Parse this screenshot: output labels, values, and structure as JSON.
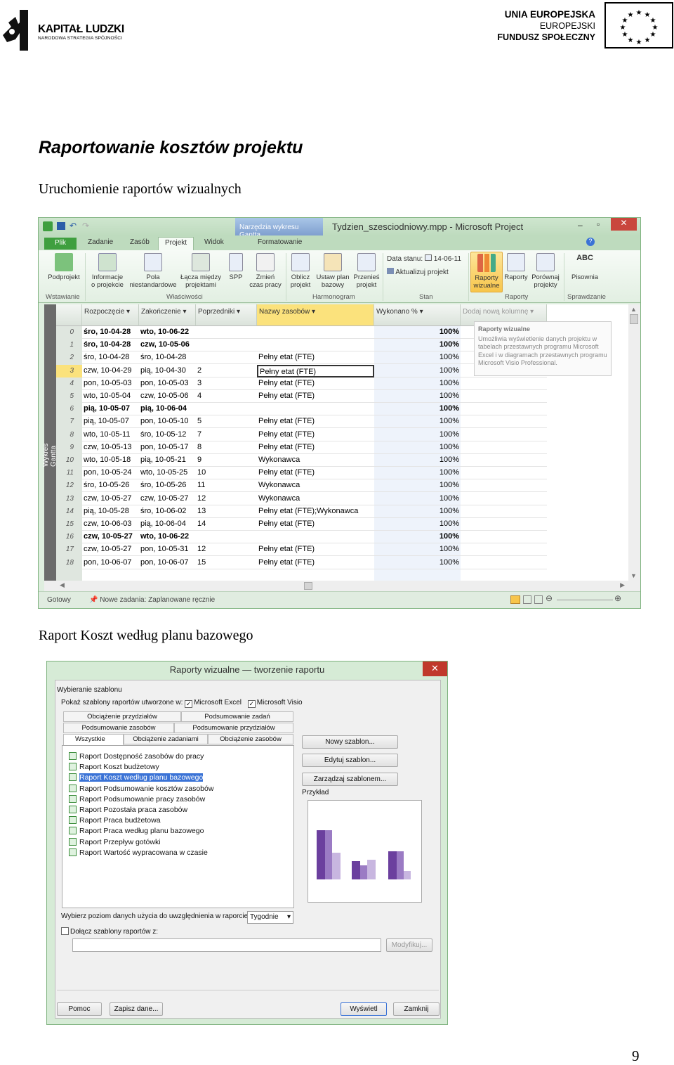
{
  "header": {
    "kl_title": "KAPITAŁ LUDZKI",
    "kl_subtitle": "NARODOWA STRATEGIA SPÓJNOŚCI",
    "ue_line1": "UNIA EUROPEJSKA",
    "ue_line2": "EUROPEJSKI",
    "ue_line3": "FUNDUSZ SPOŁECZNY"
  },
  "doc": {
    "title": "Raportowanie kosztów projektu",
    "sub1": "Uruchomienie raportów wizualnych",
    "sub2": "Raport Koszt według planu bazowego",
    "page_number": "9"
  },
  "project": {
    "app_title": "Tydzien_szesciodniowy.mpp  -  Microsoft Project",
    "context_tab": "Narzędzia wykresu Gantta",
    "tabs": [
      "Plik",
      "Zadanie",
      "Zasób",
      "Projekt",
      "Widok",
      "Formatowanie"
    ],
    "ribbon": {
      "podprojekt": "Podprojekt",
      "informacje": "Informacje\no projekcie",
      "pola": "Pola\nniestandardowe",
      "lacza": "Łącza między\nprojektami",
      "spp": "SPP",
      "zmien": "Zmień\nczas pracy",
      "oblicz": "Oblicz\nprojekt",
      "ustaw": "Ustaw plan\nbazowy",
      "przenies": "Przenieś\nprojekt",
      "data_stanu": "Data stanu:",
      "data_val": "14-06-11",
      "aktualizuj": "Aktualizuj projekt",
      "raporty_wiz": "Raporty\nwizualne",
      "raporty": "Raporty",
      "porownaj": "Porównaj\nprojekty",
      "pisownia": "Pisownia",
      "groups": [
        "Wstawianie",
        "Właściwości",
        "Harmonogram",
        "Stan",
        "Raporty",
        "Sprawdzanie"
      ]
    },
    "sidebar_label": "Wykres Gantta",
    "columns": [
      "Rozpoczęcie",
      "Zakończenie",
      "Poprzedniki",
      "Nazwy zasobów",
      "Wykonano %",
      "Dodaj nową kolumnę"
    ],
    "tooltip_title": "Raporty wizualne",
    "tooltip_text": "Umożliwia wyświetlenie danych projektu w tabelach przestawnych programu Microsoft Excel i w diagramach przestawnych programu Microsoft Visio Professional.",
    "rows": [
      {
        "n": "0",
        "start": "śro, 10-04-28",
        "end": "wto, 10-06-22",
        "pred": "",
        "res": "",
        "pct": "100%",
        "bold": true
      },
      {
        "n": "1",
        "start": "śro, 10-04-28",
        "end": "czw, 10-05-06",
        "pred": "",
        "res": "",
        "pct": "100%",
        "bold": true
      },
      {
        "n": "2",
        "start": "śro, 10-04-28",
        "end": "śro, 10-04-28",
        "pred": "",
        "res": "Pełny etat (FTE)",
        "pct": "100%",
        "bold": false
      },
      {
        "n": "3",
        "start": "czw, 10-04-29",
        "end": "pią, 10-04-30",
        "pred": "2",
        "res": "Pełny etat (FTE)",
        "pct": "100%",
        "bold": false
      },
      {
        "n": "4",
        "start": "pon, 10-05-03",
        "end": "pon, 10-05-03",
        "pred": "3",
        "res": "Pełny etat (FTE)",
        "pct": "100%",
        "bold": false
      },
      {
        "n": "5",
        "start": "wto, 10-05-04",
        "end": "czw, 10-05-06",
        "pred": "4",
        "res": "Pełny etat (FTE)",
        "pct": "100%",
        "bold": false
      },
      {
        "n": "6",
        "start": "pią, 10-05-07",
        "end": "pią, 10-06-04",
        "pred": "",
        "res": "",
        "pct": "100%",
        "bold": true
      },
      {
        "n": "7",
        "start": "pią, 10-05-07",
        "end": "pon, 10-05-10",
        "pred": "5",
        "res": "Pełny etat (FTE)",
        "pct": "100%",
        "bold": false
      },
      {
        "n": "8",
        "start": "wto, 10-05-11",
        "end": "śro, 10-05-12",
        "pred": "7",
        "res": "Pełny etat (FTE)",
        "pct": "100%",
        "bold": false
      },
      {
        "n": "9",
        "start": "czw, 10-05-13",
        "end": "pon, 10-05-17",
        "pred": "8",
        "res": "Pełny etat (FTE)",
        "pct": "100%",
        "bold": false
      },
      {
        "n": "10",
        "start": "wto, 10-05-18",
        "end": "pią, 10-05-21",
        "pred": "9",
        "res": "Wykonawca",
        "pct": "100%",
        "bold": false
      },
      {
        "n": "11",
        "start": "pon, 10-05-24",
        "end": "wto, 10-05-25",
        "pred": "10",
        "res": "Pełny etat (FTE)",
        "pct": "100%",
        "bold": false
      },
      {
        "n": "12",
        "start": "śro, 10-05-26",
        "end": "śro, 10-05-26",
        "pred": "11",
        "res": "Wykonawca",
        "pct": "100%",
        "bold": false
      },
      {
        "n": "13",
        "start": "czw, 10-05-27",
        "end": "czw, 10-05-27",
        "pred": "12",
        "res": "Wykonawca",
        "pct": "100%",
        "bold": false
      },
      {
        "n": "14",
        "start": "pią, 10-05-28",
        "end": "śro, 10-06-02",
        "pred": "13",
        "res": "Pełny etat (FTE);Wykonawca",
        "pct": "100%",
        "bold": false
      },
      {
        "n": "15",
        "start": "czw, 10-06-03",
        "end": "pią, 10-06-04",
        "pred": "14",
        "res": "Pełny etat (FTE)",
        "pct": "100%",
        "bold": false
      },
      {
        "n": "16",
        "start": "czw, 10-05-27",
        "end": "wto, 10-06-22",
        "pred": "",
        "res": "",
        "pct": "100%",
        "bold": true
      },
      {
        "n": "17",
        "start": "czw, 10-05-27",
        "end": "pon, 10-05-31",
        "pred": "12",
        "res": "Pełny etat (FTE)",
        "pct": "100%",
        "bold": false
      },
      {
        "n": "18",
        "start": "pon, 10-06-07",
        "end": "pon, 10-06-07",
        "pred": "15",
        "res": "Pełny etat (FTE)",
        "pct": "100%",
        "bold": false
      }
    ],
    "status_ready": "Gotowy",
    "status_new_tasks": "Nowe zadania: Zaplanowane ręcznie"
  },
  "dialog": {
    "title": "Raporty wizualne — tworzenie raportu",
    "group_label": "Wybieranie szablonu",
    "show_label": "Pokaż szablony raportów utworzone w:",
    "excel": "Microsoft Excel",
    "visio": "Microsoft Visio",
    "tabs_row1": [
      "Obciążenie przydziałów",
      "Podsumowanie zadań"
    ],
    "tabs_row2": [
      "Podsumowanie zasobów",
      "Podsumowanie przydziałów"
    ],
    "tabs_row3": [
      "Wszystkie",
      "Obciążenie zadaniami",
      "Obciążenie zasobów"
    ],
    "reports": [
      "Raport Dostępność zasobów do pracy",
      "Raport Koszt budżetowy",
      "Raport Koszt według planu bazowego",
      "Raport Podsumowanie kosztów zasobów",
      "Raport Podsumowanie pracy zasobów",
      "Raport Pozostała praca zasobów",
      "Raport Praca budżetowa",
      "Raport Praca według planu bazowego",
      "Raport Przepływ gotówki",
      "Raport Wartość wypracowana w czasie"
    ],
    "btn_new": "Nowy szablon...",
    "btn_edit": "Edytuj szablon...",
    "btn_manage": "Zarządzaj szablonem...",
    "example": "Przykład",
    "level_label": "Wybierz poziom danych użycia do uwzględnienia w raporcie:",
    "level_value": "Tygodnie",
    "include_label": "Dołącz szablony raportów z:",
    "btn_modify": "Modyfikuj...",
    "btn_help": "Pomoc",
    "btn_save": "Zapisz dane...",
    "btn_show": "Wyświetl",
    "btn_close": "Zamknij"
  }
}
